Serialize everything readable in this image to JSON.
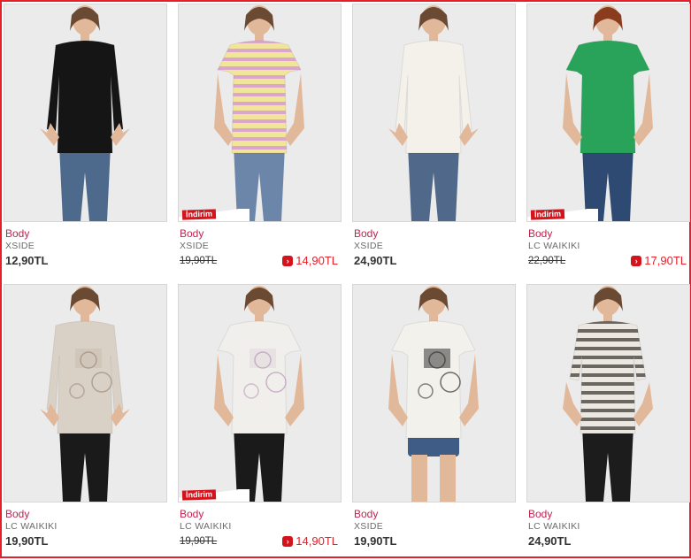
{
  "colors": {
    "accent": "#e5202a",
    "category_text": "#c0244f",
    "brand_text": "#6b6b6b",
    "price_text": "#333333",
    "sale_tag": "#d4141c"
  },
  "products": [
    {
      "category": "Body",
      "brand": "XSIDE",
      "price": "12,90TL",
      "sale": false,
      "top": "black",
      "sale_tag": ""
    },
    {
      "category": "Body",
      "brand": "XSIDE",
      "old_price": "19,90TL",
      "price": "14,90TL",
      "sale": true,
      "top": "pink-stripe",
      "sale_tag": "İndirim"
    },
    {
      "category": "Body",
      "brand": "XSIDE",
      "price": "24,90TL",
      "sale": false,
      "top": "cream",
      "sale_tag": ""
    },
    {
      "category": "Body",
      "brand": "LC WAIKIKI",
      "old_price": "22,90TL",
      "price": "17,90TL",
      "sale": true,
      "top": "green",
      "sale_tag": "İndirim"
    },
    {
      "category": "Body",
      "brand": "LC WAIKIKI",
      "price": "19,90TL",
      "sale": false,
      "top": "beige-floral",
      "sale_tag": ""
    },
    {
      "category": "Body",
      "brand": "LC WAIKIKI",
      "old_price": "19,90TL",
      "price": "14,90TL",
      "sale": true,
      "top": "white-floral",
      "sale_tag": "İndirim"
    },
    {
      "category": "Body",
      "brand": "XSIDE",
      "price": "19,90TL",
      "sale": false,
      "top": "white-paris",
      "sale_tag": ""
    },
    {
      "category": "Body",
      "brand": "LC WAIKIKI",
      "price": "24,90TL",
      "sale": false,
      "top": "grey-stripe",
      "sale_tag": ""
    }
  ]
}
